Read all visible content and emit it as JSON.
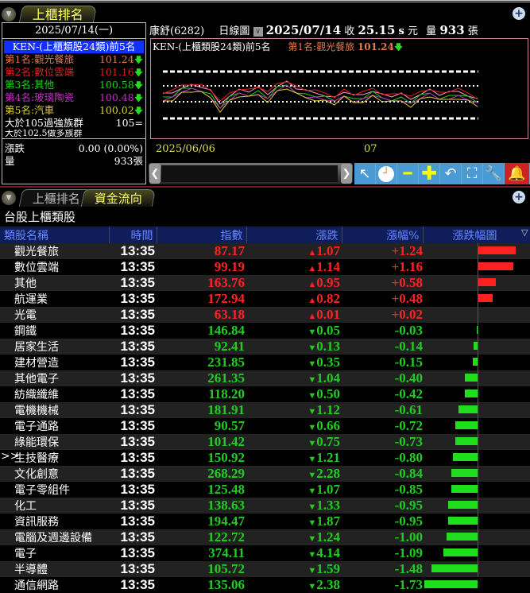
{
  "top_tabs": {
    "active": "上櫃排名"
  },
  "left_panel": {
    "date": "2025/07/14(一)",
    "title": "KEN-(上櫃類股24類)前5名",
    "ranks": [
      {
        "label": "第1名:觀光餐旅",
        "value": "101.24",
        "color": "#e07a50"
      },
      {
        "label": "第2名:數位雲端",
        "value": "101.16",
        "color": "#e02020"
      },
      {
        "label": "第3名:其他",
        "value": "100.58",
        "color": "#20d020"
      },
      {
        "label": "第4名:玻璃陶瓷",
        "value": "100.48",
        "color": "#c030c0"
      },
      {
        "label": "第5名:汽車",
        "value": "100.02",
        "color": "#e0d040"
      }
    ],
    "strong_label": "大於105過強族群",
    "strong_value": "105=",
    "bull_label": "大於102.5做多族群",
    "change_label": "漲跌",
    "change_value": "0.00 (0.00%)",
    "volume_label": "量",
    "volume_value": "933張"
  },
  "chart_header": {
    "stock": "康舒(6282)",
    "period": "日線圖",
    "date": "2025/07/14",
    "close_label": "收",
    "close": "25.15",
    "close_flag": "s",
    "unit": "元",
    "volume_label": "量",
    "volume": "933",
    "volume_unit": "張"
  },
  "chart": {
    "legend_title": "KEN-(上櫃類股24類)前5名",
    "legend_top": "第1名:觀光餐旅",
    "legend_value": "101.24",
    "x_labels": [
      "2025/06/06",
      "07"
    ]
  },
  "bottom_tabs": {
    "tab1": "上櫃排名",
    "tab2": "資金流向"
  },
  "section_title": "台股上櫃類股",
  "columns": [
    "類股名稱",
    "時間",
    "指數",
    "漲跌",
    "漲幅%",
    "漲跌幅圖"
  ],
  "rows": [
    {
      "name": "觀光餐旅",
      "time": "13:35",
      "index": "87.17",
      "change": "1.07",
      "pct": "+1.24",
      "v": 1.24
    },
    {
      "name": "數位雲端",
      "time": "13:35",
      "index": "99.19",
      "change": "1.14",
      "pct": "+1.16",
      "v": 1.16
    },
    {
      "name": "其他",
      "time": "13:35",
      "index": "163.76",
      "change": "0.95",
      "pct": "+0.58",
      "v": 0.58
    },
    {
      "name": "航運業",
      "time": "13:35",
      "index": "172.94",
      "change": "0.82",
      "pct": "+0.48",
      "v": 0.48
    },
    {
      "name": "光電",
      "time": "13:35",
      "index": "63.18",
      "change": "0.01",
      "pct": "+0.02",
      "v": 0.02
    },
    {
      "name": "鋼鐵",
      "time": "13:35",
      "index": "146.84",
      "change": "0.05",
      "pct": "-0.03",
      "v": -0.03
    },
    {
      "name": "居家生活",
      "time": "13:35",
      "index": "92.41",
      "change": "0.13",
      "pct": "-0.14",
      "v": -0.14
    },
    {
      "name": "建材營造",
      "time": "13:35",
      "index": "231.85",
      "change": "0.35",
      "pct": "-0.15",
      "v": -0.15
    },
    {
      "name": "其他電子",
      "time": "13:35",
      "index": "261.35",
      "change": "1.04",
      "pct": "-0.40",
      "v": -0.4
    },
    {
      "name": "紡織纖維",
      "time": "13:35",
      "index": "118.20",
      "change": "0.50",
      "pct": "-0.42",
      "v": -0.42
    },
    {
      "name": "電機機械",
      "time": "13:35",
      "index": "181.91",
      "change": "1.12",
      "pct": "-0.61",
      "v": -0.61
    },
    {
      "name": "電子通路",
      "time": "13:35",
      "index": "90.57",
      "change": "0.66",
      "pct": "-0.72",
      "v": -0.72
    },
    {
      "name": "綠能環保",
      "time": "13:35",
      "index": "101.42",
      "change": "0.75",
      "pct": "-0.73",
      "v": -0.73
    },
    {
      "name": "生技醫療",
      "time": "13:35",
      "index": "150.92",
      "change": "1.21",
      "pct": "-0.80",
      "v": -0.8,
      "marker": ">>"
    },
    {
      "name": "文化創意",
      "time": "13:35",
      "index": "268.29",
      "change": "2.28",
      "pct": "-0.84",
      "v": -0.84
    },
    {
      "name": "電子零組件",
      "time": "13:35",
      "index": "125.48",
      "change": "1.07",
      "pct": "-0.85",
      "v": -0.85
    },
    {
      "name": "化工",
      "time": "13:35",
      "index": "138.63",
      "change": "1.33",
      "pct": "-0.95",
      "v": -0.95
    },
    {
      "name": "資訊服務",
      "time": "13:35",
      "index": "194.47",
      "change": "1.87",
      "pct": "-0.95",
      "v": -0.95
    },
    {
      "name": "電腦及週邊設備",
      "time": "13:35",
      "index": "122.72",
      "change": "1.24",
      "pct": "-1.00",
      "v": -1.0
    },
    {
      "name": "電子",
      "time": "13:35",
      "index": "374.11",
      "change": "4.14",
      "pct": "-1.09",
      "v": -1.09
    },
    {
      "name": "半導體",
      "time": "13:35",
      "index": "105.72",
      "change": "1.59",
      "pct": "-1.48",
      "v": -1.48
    },
    {
      "name": "通信網路",
      "time": "13:35",
      "index": "135.06",
      "change": "2.38",
      "pct": "-1.73",
      "v": -1.73
    }
  ],
  "colors": {
    "up": "#ff2020",
    "down": "#20dd20",
    "header_bg": "#0f1e5a"
  }
}
